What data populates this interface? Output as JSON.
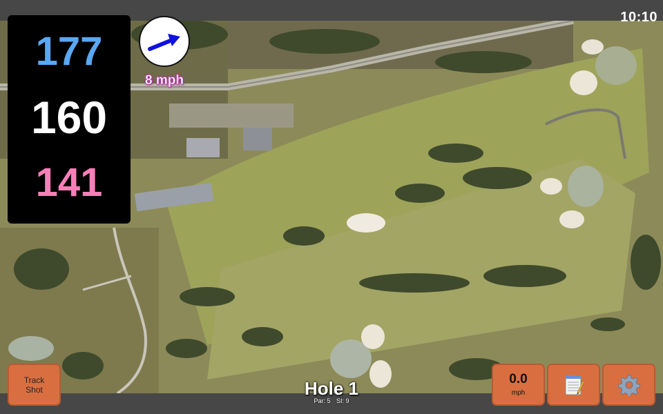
{
  "status_bar": {
    "time": "10:10"
  },
  "yardages": {
    "back": "177",
    "middle": "160",
    "front": "141"
  },
  "wind": {
    "speed_label": "8 mph",
    "arrow_icon": "wind-direction-arrow-icon",
    "arrow_color": "#1010e0"
  },
  "hole": {
    "title": "Hole 1",
    "par_label": "Par: 5",
    "si_label": "SI: 9"
  },
  "buttons": {
    "track_shot_line1": "Track",
    "track_shot_line2": "Shot",
    "speed_value": "0.0",
    "speed_unit": "mph",
    "notes_icon": "notepad-icon",
    "settings_icon": "gear-icon"
  },
  "colors": {
    "button": "#d96f41",
    "yard_back": "#5aa7f3",
    "yard_middle": "#ffffff",
    "yard_front": "#f77fb8",
    "panel": "#000000",
    "bars": "#474747"
  }
}
